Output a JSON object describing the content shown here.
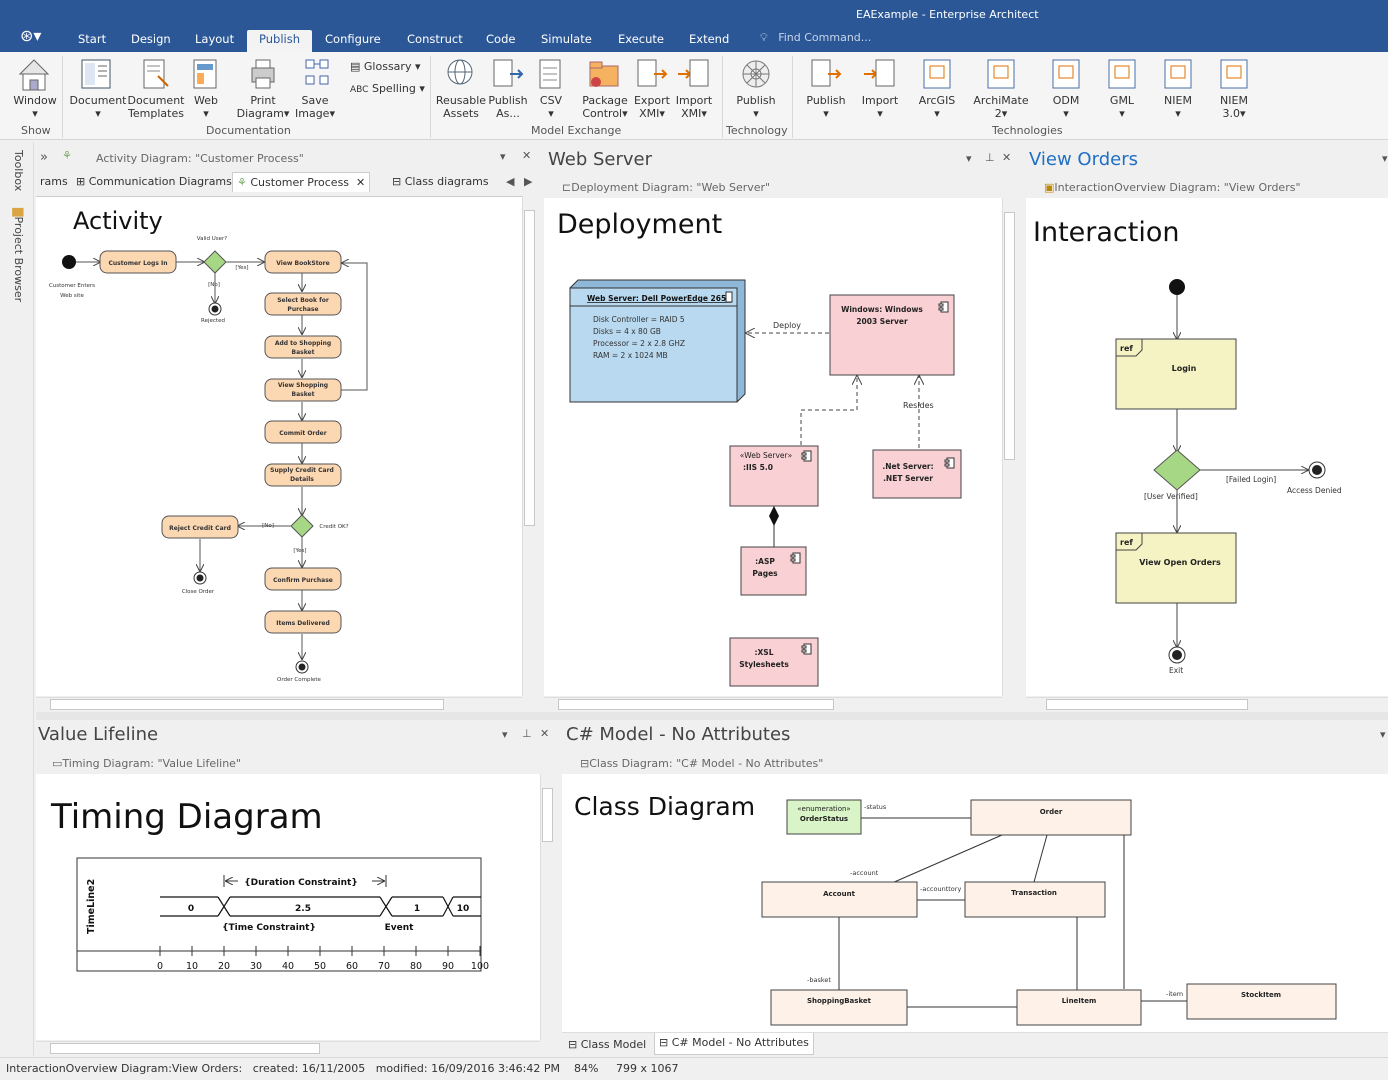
{
  "window": {
    "title": "EAExample - Enterprise Architect"
  },
  "menu": {
    "items": [
      "Start",
      "Design",
      "Layout",
      "Publish",
      "Configure",
      "Construct",
      "Code",
      "Simulate",
      "Execute",
      "Extend"
    ],
    "active": "Publish",
    "find_placeholder": "Find Command..."
  },
  "ribbon": {
    "groups": {
      "show": "Show",
      "documentation": "Documentation",
      "model_exchange": "Model Exchange",
      "technology": "Technology",
      "technologies": "Technologies"
    },
    "buttons": {
      "window": "Window",
      "document": "Document",
      "document_templates_1": "Document",
      "document_templates_2": "Templates",
      "web": "Web",
      "print_diagram_1": "Print",
      "print_diagram_2": "Diagram",
      "save_image_1": "Save",
      "save_image_2": "Image",
      "glossary": "Glossary",
      "spelling": "Spelling",
      "reusable_assets_1": "Reusable",
      "reusable_assets_2": "Assets",
      "publish_as_1": "Publish",
      "publish_as_2": "As...",
      "csv": "CSV",
      "package_control_1": "Package",
      "package_control_2": "Control",
      "export_xmi_1": "Export",
      "export_xmi_2": "XMI",
      "import_xmi_1": "Import",
      "import_xmi_2": "XMI",
      "tech_publish": "Publish",
      "publish": "Publish",
      "import": "Import",
      "arcgis": "ArcGIS",
      "archimate_1": "ArchiMate",
      "archimate_2": "2",
      "odm": "ODM",
      "gml": "GML",
      "niem": "NIEM",
      "niem3_1": "NIEM",
      "niem3_2": "3.0"
    }
  },
  "sidebar": {
    "toolbox": "Toolbox",
    "project_browser": "Project Browser"
  },
  "panes": {
    "activity": {
      "subtitle": "Activity Diagram: \"Customer Process\"",
      "tabs": [
        "rams",
        "Communication Diagrams",
        "Customer Process",
        "Class diagrams"
      ],
      "heading": "Activity",
      "nodes": {
        "customer_logs_in": "Customer Logs In",
        "view_bookstore": "View BookStore",
        "select_book_1": "Select Book for",
        "select_book_2": "Purchase",
        "add_cart_1": "Add to Shopping",
        "add_cart_2": "Basket",
        "view_cart_1": "View Shopping",
        "view_cart_2": "Basket",
        "commit_order": "Commit Order",
        "supply_cc_1": "Supply Credit Card",
        "supply_cc_2": "Details",
        "reject_cc": "Reject Credit Card",
        "confirm_purchase": "Confirm Purchase",
        "items_delivered": "Items Delivered"
      },
      "labels": {
        "valid_user": "Valid User?",
        "yes1": "[Yes]",
        "no1": "[No]",
        "rejected": "Rejected",
        "enters_1": "Customer Enters",
        "enters_2": "Web site",
        "credit_ok": "Credit OK?",
        "no2": "[No]",
        "yes2": "[Yes]",
        "close_order": "Close Order",
        "order_complete": "Order Complete"
      }
    },
    "webserver": {
      "title": "Web Server",
      "subtitle": "Deployment Diagram: \"Web Server\"",
      "heading": "Deployment",
      "node_title": "Web Server: Dell PowerEdge 2650",
      "attrs": [
        "Disk Controller = RAID 5",
        "Disks = 4 x 80 GB",
        "Processor = 2 x 2.8 GHZ",
        "RAM = 2 x 1024 MB"
      ],
      "win_1": "Windows: Windows",
      "win_2": "2003 Server",
      "deploy": "Deploy",
      "resides": "Resides",
      "iis_1": "«Web Server»",
      "iis_2": ":IIS 5.0",
      "net_1": ".Net Server:",
      "net_2": ".NET Server",
      "asp_1": ":ASP",
      "asp_2": "Pages",
      "xsl_1": ":XSL",
      "xsl_2": "Stylesheets"
    },
    "vieworders": {
      "title": "View Orders",
      "subtitle": "InteractionOverview Diagram: \"View Orders\"",
      "heading": "Interaction",
      "ref": "ref",
      "login": "Login",
      "failed": "[Failed Login]",
      "denied": "Access Denied",
      "verified": "[User Verified]",
      "open_orders": "View Open Orders",
      "exit": "Exit"
    },
    "timing": {
      "title": "Value Lifeline",
      "subtitle": "Timing Diagram: \"Value Lifeline\"",
      "heading": "Timing Diagram",
      "lifeline": "TimeLine2",
      "duration": "{Duration Constraint}",
      "time": "{Time Constraint}",
      "event": "Event",
      "states": [
        "0",
        "2.5",
        "1",
        "10"
      ],
      "ticks": [
        "0",
        "10",
        "20",
        "30",
        "40",
        "50",
        "60",
        "70",
        "80",
        "90",
        "100"
      ]
    },
    "csharp": {
      "title": "C# Model - No Attributes",
      "subtitle": "Class Diagram: \"C# Model - No Attributes\"",
      "heading": "Class Diagram",
      "enum_1": "«enumeration»",
      "enum_2": "OrderStatus",
      "status": "-status",
      "order": "Order",
      "account": "Account",
      "account_role": "-account",
      "accounttory": "-accounttory",
      "transaction": "Transaction",
      "basket_role": "-basket",
      "shopping_basket": "ShoppingBasket",
      "line_item": "LineItem",
      "item_role": "-item",
      "stock_item": "StockItem",
      "tabs": [
        "Class Model",
        "C# Model - No Attributes"
      ]
    }
  },
  "status": {
    "diagram": "InteractionOverview Diagram:View Orders:",
    "created": "created: 16/11/2005",
    "modified": "modified: 16/09/2016 3:46:42 PM",
    "zoom": "84%",
    "size": "799 x 1067"
  },
  "colors": {
    "title_bar": "#2b5797",
    "activity_fill": "#fbd7b2",
    "deploy_node": "#b9d9f0",
    "component": "#f9d0d3",
    "io_fill": "#f5f3c4",
    "class_fill": "#fdf1e8",
    "enum_fill": "#d9f5c7"
  }
}
